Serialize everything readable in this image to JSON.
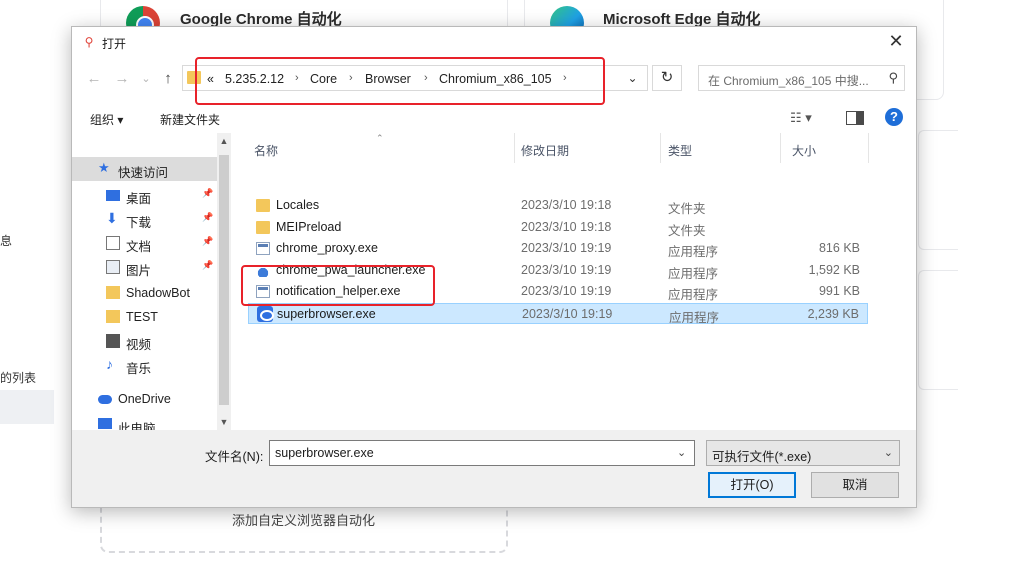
{
  "background": {
    "nav_fragments": [
      "息",
      "的列表"
    ],
    "cards": {
      "chrome_title": "Google Chrome 自动化",
      "edge_title": "Microsoft Edge 自动化",
      "custom_label": "添加自定义浏览器自动化"
    }
  },
  "dialog": {
    "title": "打开",
    "close_glyph": "✕",
    "nav": {
      "back": "←",
      "forward": "→",
      "recent": "⌄",
      "up": "↑"
    },
    "breadcrumb": {
      "overflow": "«",
      "separator": "›",
      "items": [
        "5.235.2.12",
        "Core",
        "Browser",
        "Chromium_x86_105"
      ]
    },
    "address_dropdown_glyph": "⌄",
    "refresh_glyph": "↻",
    "search": {
      "placeholder": "在 Chromium_x86_105 中搜...",
      "icon": "search-icon"
    },
    "toolbar": {
      "organize": "组织 ▾",
      "new_folder": "新建文件夹",
      "view": "☷ ▾",
      "help": "?"
    },
    "nav_pane": {
      "items": [
        {
          "label": "快速访问",
          "icon": "star-icon",
          "pinned": false
        },
        {
          "label": "桌面",
          "icon": "desktop-icon",
          "pinned": true
        },
        {
          "label": "下载",
          "icon": "download-icon",
          "pinned": true
        },
        {
          "label": "文档",
          "icon": "document-icon",
          "pinned": true
        },
        {
          "label": "图片",
          "icon": "picture-icon",
          "pinned": true
        },
        {
          "label": "ShadowBot",
          "icon": "folder-icon",
          "pinned": false
        },
        {
          "label": "TEST",
          "icon": "folder-icon",
          "pinned": false
        },
        {
          "label": "视频",
          "icon": "video-icon",
          "pinned": false
        },
        {
          "label": "音乐",
          "icon": "music-icon",
          "pinned": false
        },
        {
          "label": "OneDrive",
          "icon": "cloud-icon",
          "pinned": false
        },
        {
          "label": "此电脑",
          "icon": "computer-icon",
          "pinned": false
        }
      ]
    },
    "columns": {
      "name": "名称",
      "date": "修改日期",
      "type": "类型",
      "size": "大小"
    },
    "files": [
      {
        "name": "Locales",
        "date": "2023/3/10 19:18",
        "type": "文件夹",
        "size": "",
        "icon": "folder-icon"
      },
      {
        "name": "MEIPreload",
        "date": "2023/3/10 19:18",
        "type": "文件夹",
        "size": "",
        "icon": "folder-icon"
      },
      {
        "name": "chrome_proxy.exe",
        "date": "2023/3/10 19:19",
        "type": "应用程序",
        "size": "816 KB",
        "icon": "exe-icon"
      },
      {
        "name": "chrome_pwa_launcher.exe",
        "date": "2023/3/10 19:19",
        "type": "应用程序",
        "size": "1,592 KB",
        "icon": "pwa-launcher-icon"
      },
      {
        "name": "notification_helper.exe",
        "date": "2023/3/10 19:19",
        "type": "应用程序",
        "size": "991 KB",
        "icon": "exe-icon"
      },
      {
        "name": "superbrowser.exe",
        "date": "2023/3/10 19:19",
        "type": "应用程序",
        "size": "2,239 KB",
        "icon": "superbrowser-icon",
        "selected": true
      }
    ],
    "filename": {
      "label": "文件名(N):",
      "value": "superbrowser.exe"
    },
    "filetype": {
      "value": "可执行文件(*.exe)"
    },
    "buttons": {
      "open": "打开(O)",
      "cancel": "取消"
    },
    "accent_color": "#0078d7",
    "annotation_color": "#e8222a"
  }
}
